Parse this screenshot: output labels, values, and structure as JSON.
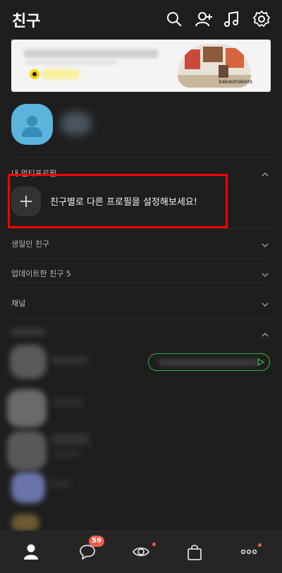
{
  "header": {
    "title": "친구",
    "icons": [
      "search-icon",
      "add-friend-icon",
      "music-icon",
      "settings-icon"
    ]
  },
  "banner": {
    "brand": "kakaomakers"
  },
  "sections": {
    "multi_profile": "내 멀티프로필",
    "birthday": "생일인 친구",
    "updated": "업데이트한 친구 5",
    "channel": "채널"
  },
  "multi_profile_prompt": "친구별로 다른 프로필을 설정해보세요!",
  "tabbar": {
    "items": [
      "friends-tab",
      "chats-tab",
      "view-tab",
      "shopping-tab",
      "more-tab"
    ],
    "chat_badge": "59"
  },
  "colors": {
    "background": "#1e1e1e",
    "highlight": "#ff0000",
    "badge": "#ef5c46",
    "status_border": "#35b24a"
  }
}
